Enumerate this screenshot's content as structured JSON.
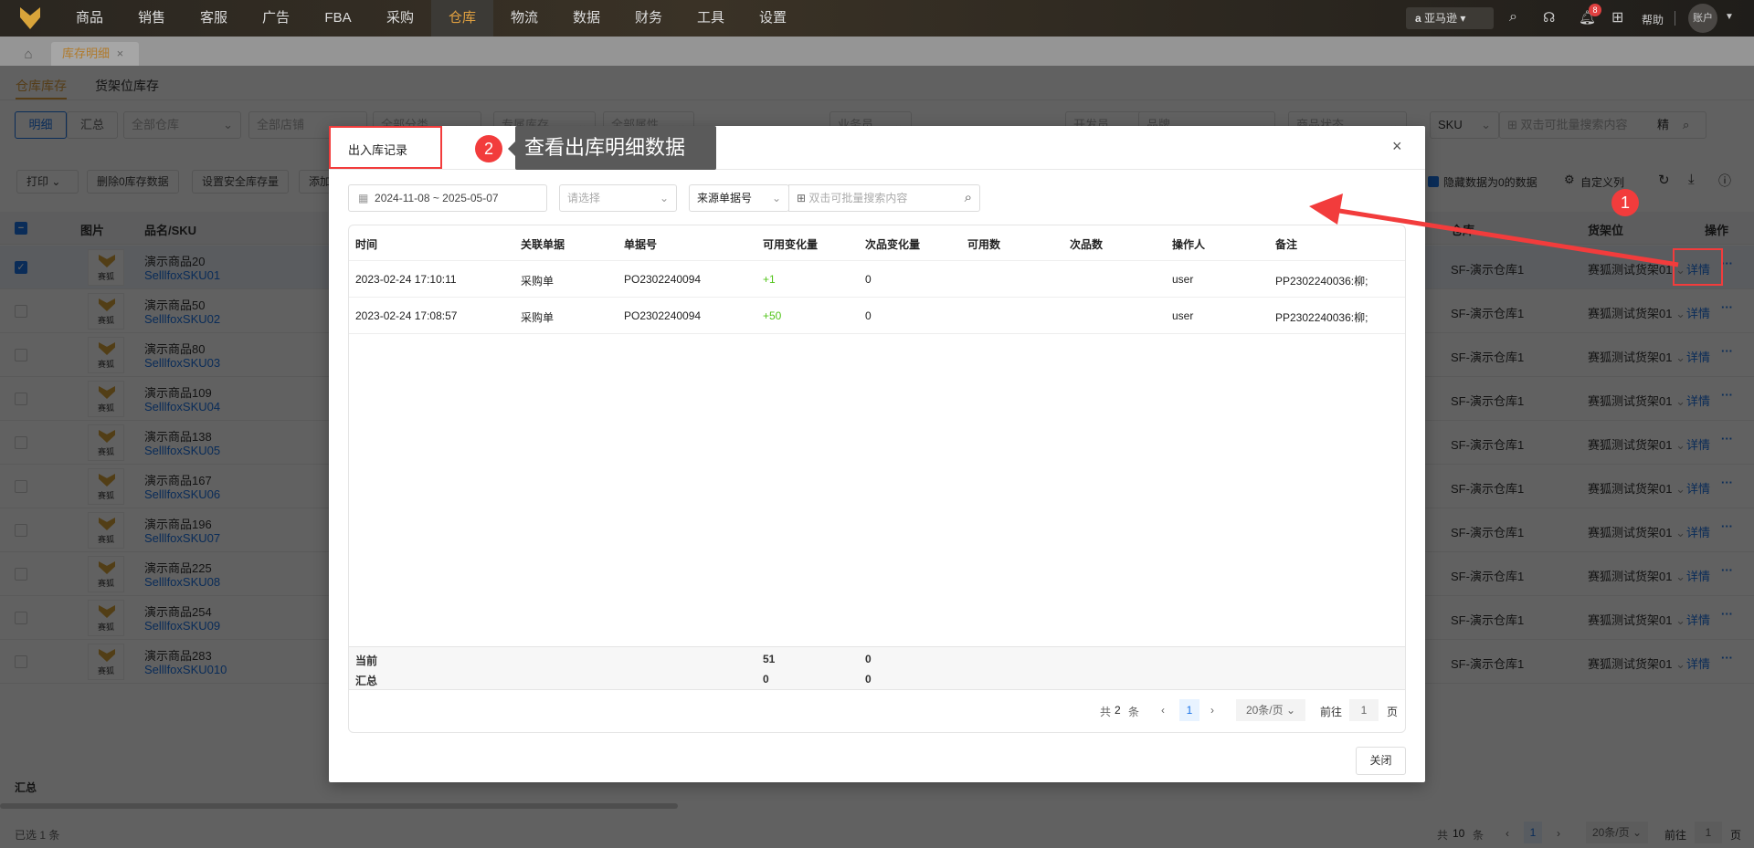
{
  "topnav": {
    "items": [
      "商品",
      "销售",
      "客服",
      "广告",
      "FBA",
      "采购",
      "仓库",
      "物流",
      "数据",
      "财务",
      "工具",
      "设置"
    ],
    "active": "仓库",
    "platform": "亚马逊",
    "notification_count": "8",
    "help": "帮助",
    "account": "账户"
  },
  "tabs": {
    "active_tab": "库存明细"
  },
  "subtabs": [
    "仓库库存",
    "货架位库存"
  ],
  "filters": {
    "mode": [
      "明细",
      "汇总"
    ],
    "selects": [
      "全部仓库",
      "全部店铺",
      "全部分类",
      "专属库存",
      "全部属性",
      "业务员",
      "开发员",
      "品牌",
      "商品状态"
    ],
    "search_type": "SKU",
    "search_placeholder": "双击可批量搜索内容",
    "exact": "精"
  },
  "toolbar": {
    "print": "打印",
    "delete_zero": "删除0库存数据",
    "safety_stock": "设置安全库存量",
    "add": "添加",
    "hide_zero": "隐藏数据为0的数据",
    "custom_columns": "自定义列"
  },
  "table": {
    "headers": {
      "image": "图片",
      "name_sku": "品名/SKU",
      "warehouse": "仓库",
      "shelf": "货架位",
      "action": "操作"
    },
    "rows": [
      {
        "name": "演示商品20",
        "sku": "SelllfoxSKU01",
        "checked": true
      },
      {
        "name": "演示商品50",
        "sku": "SelllfoxSKU02"
      },
      {
        "name": "演示商品80",
        "sku": "SelllfoxSKU03"
      },
      {
        "name": "演示商品109",
        "sku": "SelllfoxSKU04"
      },
      {
        "name": "演示商品138",
        "sku": "SelllfoxSKU05"
      },
      {
        "name": "演示商品167",
        "sku": "SelllfoxSKU06"
      },
      {
        "name": "演示商品196",
        "sku": "SelllfoxSKU07"
      },
      {
        "name": "演示商品225",
        "sku": "SelllfoxSKU08"
      },
      {
        "name": "演示商品254",
        "sku": "SelllfoxSKU09"
      },
      {
        "name": "演示商品283",
        "sku": "SelllfoxSKU010"
      }
    ],
    "warehouse": "SF-演示仓库1",
    "shelf": "赛狐测试货架01",
    "detail": "详情",
    "thumb_label": "赛狐",
    "summary": "汇总"
  },
  "footer": {
    "selected": "已选 1 条",
    "total_prefix": "共",
    "total": "10",
    "total_suffix": "条",
    "page": "1",
    "page_size": "20条/页",
    "goto": "前往",
    "goto_value": "1",
    "page_suffix": "页"
  },
  "modal": {
    "title": "出入库记录",
    "date_range": "2024-11-08 ~ 2025-05-07",
    "select_placeholder": "请选择",
    "source_type": "来源单据号",
    "search_placeholder": "双击可批量搜索内容",
    "headers": [
      "时间",
      "关联单据",
      "单据号",
      "可用变化量",
      "次品变化量",
      "可用数",
      "次品数",
      "操作人",
      "备注"
    ],
    "rows": [
      [
        "2023-02-24 17:10:11",
        "采购单",
        "PO2302240094",
        "+1",
        "0",
        "",
        "",
        "user",
        "PP2302240036:柳;"
      ],
      [
        "2023-02-24 17:08:57",
        "采购单",
        "PO2302240094",
        "+50",
        "0",
        "",
        "",
        "user",
        "PP2302240036:柳;"
      ]
    ],
    "summary": {
      "current_label": "当前",
      "current_avail": "51",
      "current_defect": "0",
      "total_label": "汇总",
      "total_avail": "0",
      "total_defect": "0"
    },
    "pagination": {
      "prefix": "共",
      "total": "2",
      "suffix": "条",
      "page": "1",
      "page_size": "20条/页",
      "goto": "前往",
      "goto_value": "1",
      "page_suffix": "页"
    },
    "close": "关闭"
  },
  "annotations": {
    "step1": "1",
    "step2": "2",
    "tooltip": "查看出库明细数据"
  },
  "colors": {
    "accent": "#1a73e8",
    "brand": "#e0a040",
    "positive": "#52c41a",
    "annotation": "#f23c3c"
  }
}
